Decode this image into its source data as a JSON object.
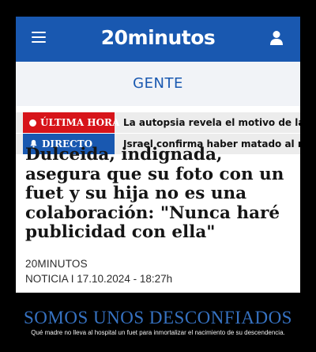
{
  "header": {
    "logo": "20minutos",
    "menu_icon": "hamburger-menu-icon",
    "user_icon": "user-icon",
    "brand_color": "#1958b0"
  },
  "section": {
    "label": "GENTE"
  },
  "tickers": [
    {
      "tag": "ÚLTIMA HORA",
      "icon": "live-dot-icon",
      "color": "#d7141a",
      "text": "La autopsia revela el motivo de la muerte"
    },
    {
      "tag": "DIRECTO",
      "icon": "bell-icon",
      "color": "#1958b0",
      "text": "Israel confirma haber matado al máximo"
    }
  ],
  "article": {
    "headline": "Dulceida, indignada, asegura que su foto con un fuet y su hija no es una colaboración: \"Nunca haré publicidad con ella\"",
    "author": "20MINUTOS",
    "meta": "NOTICIA I 17.10.2024 - 18:27h"
  },
  "caption": {
    "title": "SOMOS UNOS DESCONFIADOS",
    "subtitle": "Qué madre no lleva al hospital un fuet para inmortalizar el nacimiento de su descendencia."
  }
}
